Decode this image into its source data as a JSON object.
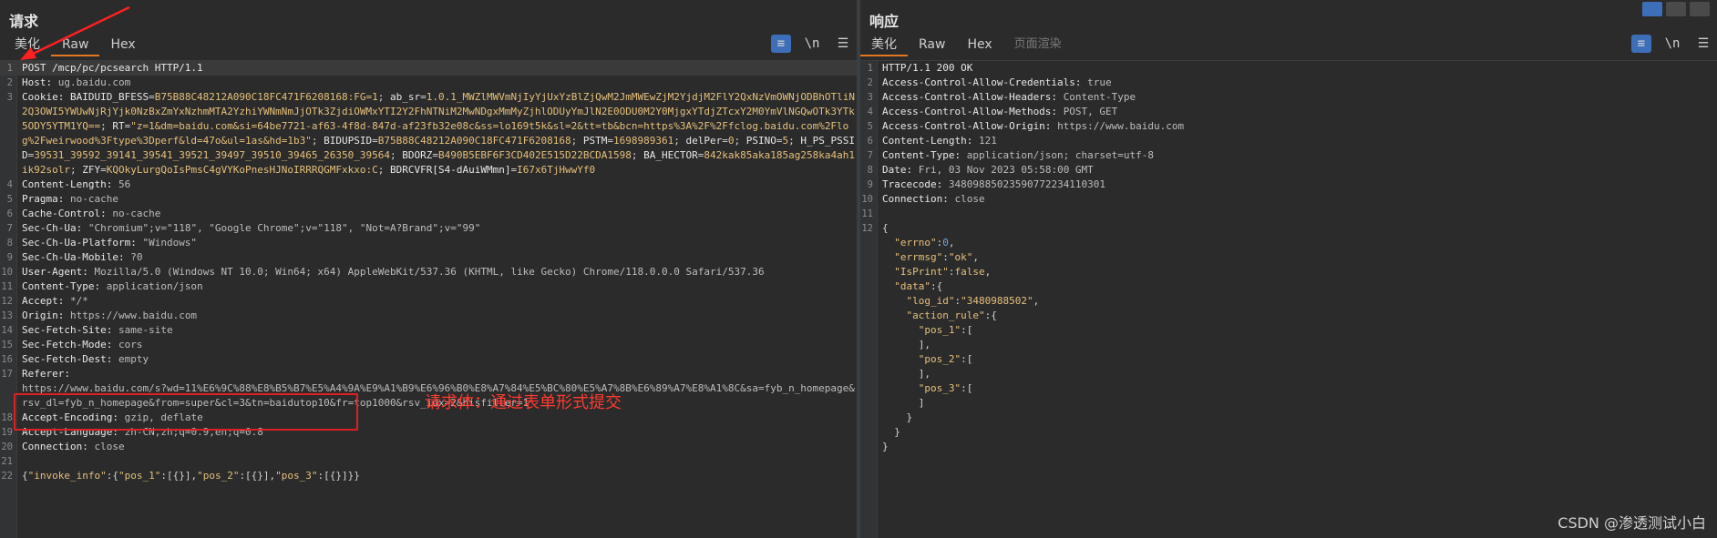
{
  "request": {
    "title": "请求",
    "tabs": [
      "美化",
      "Raw",
      "Hex"
    ],
    "active_tab": "Raw",
    "tools": {
      "wrap": "≡",
      "newline": "\\n",
      "menu": "☰"
    },
    "lines": [
      {
        "n": "1",
        "parts": [
          [
            "hn",
            "POST /mcp/pc/pcsearch HTTP/1.1"
          ]
        ],
        "hl": true
      },
      {
        "n": "2",
        "parts": [
          [
            "hn",
            "Host: "
          ],
          [
            "hv",
            "ug.baidu.com"
          ]
        ]
      },
      {
        "n": "3",
        "parts": [
          [
            "hn",
            "Cookie: "
          ],
          [
            "ck",
            "BAIDUID_BFESS"
          ],
          [
            "pun",
            "="
          ],
          [
            "cv",
            "B75B88C48212A090C18FC471F6208168:FG=1"
          ],
          [
            "pun",
            "; "
          ],
          [
            "ck",
            "ab_sr"
          ],
          [
            "pun",
            "="
          ],
          [
            "cv",
            "1.0.1_MWZlMWVmNjIyYjUxYzBlZjQwM2JmMWEwZjM2YjdjM2FlY2QxNzVmOWNjODBhOTliN2Q3OWI5YWUwNjRjYjk0NzBxZmYxNzhmMTA2YzhiYWNmNmJjOTk3ZjdiOWMxYTI2Y2FhNTNiM2MwNDgxMmMyZjhlODUyYmJlN2E0ODU0M2Y0MjgxYTdjZTcxY2M0YmVlNGQwOTk3YTk5ODY5YTM1YQ=="
          ],
          [
            "pun",
            "; "
          ],
          [
            "ck",
            "RT"
          ],
          [
            "pun",
            "="
          ],
          [
            "cv",
            "\"z=1&dm=baidu.com&si=64be7721-af63-4f8d-847d-af23fb32e08c&ss=lo169t5k&sl=2&tt=tb&bcn=https%3A%2F%2Ffclog.baidu.com%2Flog%2Fweirwood%3Ftype%3Dperf&ld=47o&ul=1as&hd=1b3\""
          ],
          [
            "pun",
            "; "
          ],
          [
            "ck",
            "BIDUPSID"
          ],
          [
            "pun",
            "="
          ],
          [
            "cv",
            "B75B88C48212A090C18FC471F6208168"
          ],
          [
            "pun",
            "; "
          ],
          [
            "ck",
            "PSTM"
          ],
          [
            "pun",
            "="
          ],
          [
            "cv",
            "1698989361"
          ],
          [
            "pun",
            "; "
          ],
          [
            "ck",
            "delPer"
          ],
          [
            "pun",
            "="
          ],
          [
            "cv",
            "0"
          ],
          [
            "pun",
            "; "
          ],
          [
            "ck",
            "PSINO"
          ],
          [
            "pun",
            "="
          ],
          [
            "cv",
            "5"
          ],
          [
            "pun",
            "; "
          ],
          [
            "ck",
            "H_PS_PSSID"
          ],
          [
            "pun",
            "="
          ],
          [
            "cv",
            "39531_39592_39141_39541_39521_39497_39510_39465_26350_39564"
          ],
          [
            "pun",
            "; "
          ],
          [
            "ck",
            "BDORZ"
          ],
          [
            "pun",
            "="
          ],
          [
            "cv",
            "B490B5EBF6F3CD402E515D22BCDA1598"
          ],
          [
            "pun",
            "; "
          ],
          [
            "ck",
            "BA_HECTOR"
          ],
          [
            "pun",
            "="
          ],
          [
            "cv",
            "842kak85aka185ag258ka4ah1ik92solr"
          ],
          [
            "pun",
            "; "
          ],
          [
            "ck",
            "ZFY"
          ],
          [
            "pun",
            "="
          ],
          [
            "cv",
            "KQOkyLurgQoIsPmsC4gVYKoPnesHJNoIRRRQGMFxkxo:C"
          ],
          [
            "pun",
            "; "
          ],
          [
            "ck",
            "BDRCVFR[S4-dAuiWMmn]"
          ],
          [
            "pun",
            "="
          ],
          [
            "cv",
            "I67x6TjHwwYf0"
          ]
        ]
      },
      {
        "n": "4",
        "parts": [
          [
            "hn",
            "Content-Length: "
          ],
          [
            "hv",
            "56"
          ]
        ]
      },
      {
        "n": "5",
        "parts": [
          [
            "hn",
            "Pragma: "
          ],
          [
            "hv",
            "no-cache"
          ]
        ]
      },
      {
        "n": "6",
        "parts": [
          [
            "hn",
            "Cache-Control: "
          ],
          [
            "hv",
            "no-cache"
          ]
        ]
      },
      {
        "n": "7",
        "parts": [
          [
            "hn",
            "Sec-Ch-Ua: "
          ],
          [
            "hv",
            "\"Chromium\";v=\"118\", \"Google Chrome\";v=\"118\", \"Not=A?Brand\";v=\"99\""
          ]
        ]
      },
      {
        "n": "8",
        "parts": [
          [
            "hn",
            "Sec-Ch-Ua-Platform: "
          ],
          [
            "hv",
            "\"Windows\""
          ]
        ]
      },
      {
        "n": "9",
        "parts": [
          [
            "hn",
            "Sec-Ch-Ua-Mobile: "
          ],
          [
            "hv",
            "?0"
          ]
        ]
      },
      {
        "n": "10",
        "parts": [
          [
            "hn",
            "User-Agent: "
          ],
          [
            "hv",
            "Mozilla/5.0 (Windows NT 10.0; Win64; x64) AppleWebKit/537.36 (KHTML, like Gecko) Chrome/118.0.0.0 Safari/537.36"
          ]
        ]
      },
      {
        "n": "11",
        "parts": [
          [
            "hn",
            "Content-Type: "
          ],
          [
            "hv",
            "application/json"
          ]
        ]
      },
      {
        "n": "12",
        "parts": [
          [
            "hn",
            "Accept: "
          ],
          [
            "hv",
            "*/*"
          ]
        ]
      },
      {
        "n": "13",
        "parts": [
          [
            "hn",
            "Origin: "
          ],
          [
            "hv",
            "https://www.baidu.com"
          ]
        ]
      },
      {
        "n": "14",
        "parts": [
          [
            "hn",
            "Sec-Fetch-Site: "
          ],
          [
            "hv",
            "same-site"
          ]
        ]
      },
      {
        "n": "15",
        "parts": [
          [
            "hn",
            "Sec-Fetch-Mode: "
          ],
          [
            "hv",
            "cors"
          ]
        ]
      },
      {
        "n": "16",
        "parts": [
          [
            "hn",
            "Sec-Fetch-Dest: "
          ],
          [
            "hv",
            "empty"
          ]
        ]
      },
      {
        "n": "17",
        "parts": [
          [
            "hn",
            "Referer: "
          ],
          [
            "hv",
            "\nhttps://www.baidu.com/s?wd=11%E6%9C%88%E8%B5%B7%E5%A4%9A%E9%A1%B9%E6%96%B0%E8%A7%84%E5%BC%80%E5%A7%8B%E6%89%A7%E8%A1%8C&sa=fyb_n_homepage&rsv_dl=fyb_n_homepage&from=super&cl=3&tn=baidutop10&fr=top1000&rsv_idx=2&hisfilter=1"
          ]
        ]
      },
      {
        "n": "18",
        "parts": [
          [
            "hn",
            "Accept-Encoding: "
          ],
          [
            "hv",
            "gzip, deflate"
          ]
        ]
      },
      {
        "n": "19",
        "parts": [
          [
            "hn",
            "Accept-Language: "
          ],
          [
            "hv",
            "zh-CN,zh;q=0.9,en;q=0.8"
          ]
        ]
      },
      {
        "n": "20",
        "parts": [
          [
            "hn",
            "Connection: "
          ],
          [
            "hv",
            "close"
          ]
        ]
      },
      {
        "n": "21",
        "parts": [
          [
            "hv",
            ""
          ]
        ]
      },
      {
        "n": "22",
        "parts": [
          [
            "pun",
            "{"
          ],
          [
            "str",
            "\"invoke_info\""
          ],
          [
            "pun",
            ":{"
          ],
          [
            "str",
            "\"pos_1\""
          ],
          [
            "pun",
            ":[{}],"
          ],
          [
            "str",
            "\"pos_2\""
          ],
          [
            "pun",
            ":[{}],"
          ],
          [
            "str",
            "\"pos_3\""
          ],
          [
            "pun",
            ":[{}]}}"
          ]
        ]
      }
    ],
    "annotation": "请求体：通过表单形式提交"
  },
  "response": {
    "title": "响应",
    "tabs": [
      "美化",
      "Raw",
      "Hex",
      "页面渲染"
    ],
    "active_tab": "美化",
    "tools": {
      "wrap": "≡",
      "newline": "\\n",
      "menu": "☰"
    },
    "lines": [
      {
        "n": "1",
        "parts": [
          [
            "hn",
            "HTTP/1.1 200 OK"
          ]
        ]
      },
      {
        "n": "2",
        "parts": [
          [
            "hn",
            "Access-Control-Allow-Credentials: "
          ],
          [
            "hv",
            "true"
          ]
        ]
      },
      {
        "n": "3",
        "parts": [
          [
            "hn",
            "Access-Control-Allow-Headers: "
          ],
          [
            "hv",
            "Content-Type"
          ]
        ]
      },
      {
        "n": "4",
        "parts": [
          [
            "hn",
            "Access-Control-Allow-Methods: "
          ],
          [
            "hv",
            "POST, GET"
          ]
        ]
      },
      {
        "n": "5",
        "parts": [
          [
            "hn",
            "Access-Control-Allow-Origin: "
          ],
          [
            "hv",
            "https://www.baidu.com"
          ]
        ]
      },
      {
        "n": "6",
        "parts": [
          [
            "hn",
            "Content-Length: "
          ],
          [
            "hv",
            "121"
          ]
        ]
      },
      {
        "n": "7",
        "parts": [
          [
            "hn",
            "Content-Type: "
          ],
          [
            "hv",
            "application/json; charset=utf-8"
          ]
        ]
      },
      {
        "n": "8",
        "parts": [
          [
            "hn",
            "Date: "
          ],
          [
            "hv",
            "Fri, 03 Nov 2023 05:58:00 GMT"
          ]
        ]
      },
      {
        "n": "9",
        "parts": [
          [
            "hn",
            "Tracecode: "
          ],
          [
            "hv",
            "34809885023590772234110301"
          ]
        ]
      },
      {
        "n": "10",
        "parts": [
          [
            "hn",
            "Connection: "
          ],
          [
            "hv",
            "close"
          ]
        ]
      },
      {
        "n": "11",
        "parts": [
          [
            "hv",
            ""
          ]
        ]
      },
      {
        "n": "12",
        "parts": [
          [
            "pun",
            "{"
          ]
        ]
      },
      {
        "n": "",
        "parts": [
          [
            "pun",
            "  "
          ],
          [
            "str",
            "\"errno\""
          ],
          [
            "pun",
            ":"
          ],
          [
            "num",
            "0"
          ],
          [
            "pun",
            ","
          ]
        ]
      },
      {
        "n": "",
        "parts": [
          [
            "pun",
            "  "
          ],
          [
            "str",
            "\"errmsg\""
          ],
          [
            "pun",
            ":"
          ],
          [
            "str",
            "\"ok\""
          ],
          [
            "pun",
            ","
          ]
        ]
      },
      {
        "n": "",
        "parts": [
          [
            "pun",
            "  "
          ],
          [
            "str",
            "\"IsPrint\""
          ],
          [
            "pun",
            ":"
          ],
          [
            "str",
            "false"
          ],
          [
            "pun",
            ","
          ]
        ]
      },
      {
        "n": "",
        "parts": [
          [
            "pun",
            "  "
          ],
          [
            "str",
            "\"data\""
          ],
          [
            "pun",
            ":{"
          ]
        ]
      },
      {
        "n": "",
        "parts": [
          [
            "pun",
            "    "
          ],
          [
            "str",
            "\"log_id\""
          ],
          [
            "pun",
            ":"
          ],
          [
            "str",
            "\"3480988502\""
          ],
          [
            "pun",
            ","
          ]
        ]
      },
      {
        "n": "",
        "parts": [
          [
            "pun",
            "    "
          ],
          [
            "str",
            "\"action_rule\""
          ],
          [
            "pun",
            ":{"
          ]
        ]
      },
      {
        "n": "",
        "parts": [
          [
            "pun",
            "      "
          ],
          [
            "str",
            "\"pos_1\""
          ],
          [
            "pun",
            ":["
          ]
        ]
      },
      {
        "n": "",
        "parts": [
          [
            "pun",
            "      ],"
          ]
        ]
      },
      {
        "n": "",
        "parts": [
          [
            "pun",
            "      "
          ],
          [
            "str",
            "\"pos_2\""
          ],
          [
            "pun",
            ":["
          ]
        ]
      },
      {
        "n": "",
        "parts": [
          [
            "pun",
            "      ],"
          ]
        ]
      },
      {
        "n": "",
        "parts": [
          [
            "pun",
            "      "
          ],
          [
            "str",
            "\"pos_3\""
          ],
          [
            "pun",
            ":["
          ]
        ]
      },
      {
        "n": "",
        "parts": [
          [
            "pun",
            "      ]"
          ]
        ]
      },
      {
        "n": "",
        "parts": [
          [
            "pun",
            "    }"
          ]
        ]
      },
      {
        "n": "",
        "parts": [
          [
            "pun",
            "  }"
          ]
        ]
      },
      {
        "n": "",
        "parts": [
          [
            "pun",
            "}"
          ]
        ]
      }
    ]
  },
  "watermark": "CSDN @渗透测试小白",
  "colors": {
    "accent": "#e2781f",
    "highlight": "#ff3b30",
    "tool_active": "#3d6fb8"
  }
}
